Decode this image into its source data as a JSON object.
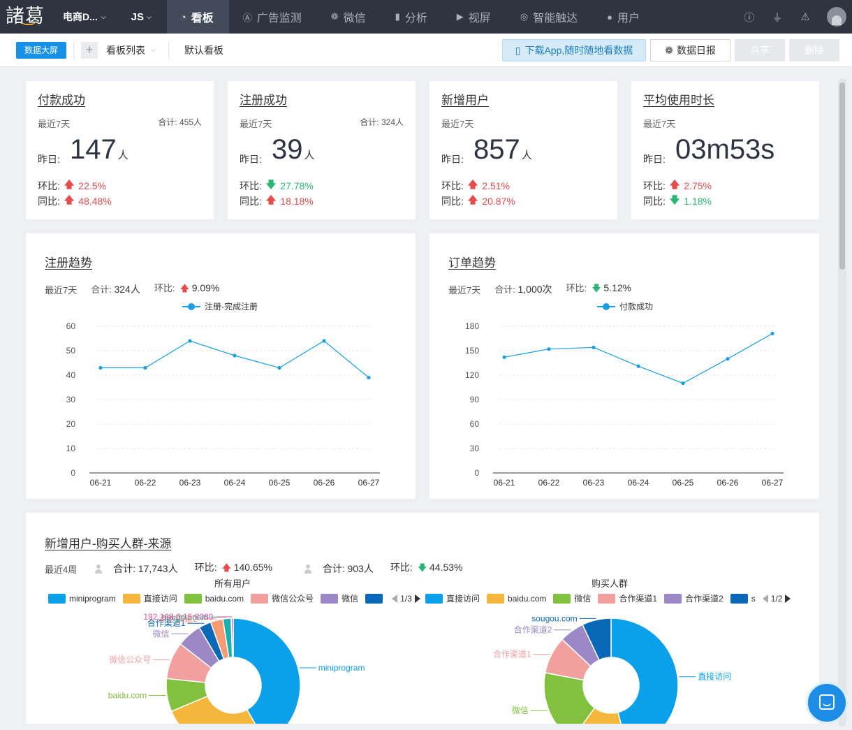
{
  "nav": {
    "logo": "諸葛",
    "project": "电商D...",
    "sdk": "JS",
    "items": [
      {
        "label": "看板",
        "icon": "chart-icon",
        "active": true
      },
      {
        "label": "广告监测",
        "icon": "ad-icon",
        "active": false
      },
      {
        "label": "微信",
        "icon": "wechat-icon",
        "active": false
      },
      {
        "label": "分析",
        "icon": "bar-chart-icon",
        "active": false
      },
      {
        "label": "视屏",
        "icon": "video-icon",
        "active": false
      },
      {
        "label": "智能触达",
        "icon": "target-icon",
        "active": false
      },
      {
        "label": "用户",
        "icon": "user-icon",
        "active": false
      }
    ]
  },
  "toolbar": {
    "screen_btn": "数据大屏",
    "board_list": "看板列表",
    "default_board": "默认看板",
    "download_app": "下载App,随时随地看数据",
    "daily_report": "数据日报",
    "share": "共享",
    "delete": "删除"
  },
  "kpis": [
    {
      "title": "付款成功",
      "period": "最近7天",
      "total": "合计: 455人",
      "yesterday_label": "昨日:",
      "value": "147",
      "unit": "人",
      "hb_label": "环比:",
      "hb": "22.5%",
      "hb_dir": "up",
      "tb_label": "同比:",
      "tb": "48.48%",
      "tb_dir": "up"
    },
    {
      "title": "注册成功",
      "period": "最近7天",
      "total": "合计: 324人",
      "yesterday_label": "昨日:",
      "value": "39",
      "unit": "人",
      "hb_label": "环比:",
      "hb": "27.78%",
      "hb_dir": "down",
      "tb_label": "同比:",
      "tb": "18.18%",
      "tb_dir": "up"
    },
    {
      "title": "新增用户",
      "period": "最近7天",
      "total": "",
      "yesterday_label": "昨日:",
      "value": "857",
      "unit": "人",
      "hb_label": "环比:",
      "hb": "2.51%",
      "hb_dir": "up",
      "tb_label": "同比:",
      "tb": "20.87%",
      "tb_dir": "up"
    },
    {
      "title": "平均使用时长",
      "period": "最近7天",
      "total": "",
      "yesterday_label": "昨日:",
      "value": "03m53s",
      "unit": "",
      "hb_label": "环比:",
      "hb": "2.75%",
      "hb_dir": "up",
      "tb_label": "同比:",
      "tb": "1.18%",
      "tb_dir": "down"
    }
  ],
  "trend_cards": [
    {
      "title": "注册趋势",
      "period": "最近7天",
      "total_label": "合计:",
      "total": "324人",
      "hb_label": "环比:",
      "hb": "9.09%",
      "hb_dir": "up"
    },
    {
      "title": "订单趋势",
      "period": "最近7天",
      "total_label": "合计:",
      "total": "1,000次",
      "hb_label": "环比:",
      "hb": "5.12%",
      "hb_dir": "down"
    }
  ],
  "pie_card": {
    "title": "新增用户-购买人群-来源",
    "period": "最近4周",
    "left": {
      "total_label": "合计:",
      "total": "17,743人",
      "hb_label": "环比:",
      "hb": "140.65%",
      "hb_dir": "up",
      "pager": "1/3"
    },
    "right": {
      "total_label": "合计:",
      "total": "903人",
      "hb_label": "环比:",
      "hb": "44.53%",
      "hb_dir": "down",
      "pager": "1/2"
    }
  },
  "chart_data": [
    {
      "type": "line",
      "series": [
        {
          "name": "注册-完成注册",
          "values": [
            43,
            43,
            54,
            48,
            43,
            54,
            39
          ]
        }
      ],
      "categories": [
        "06-21",
        "06-22",
        "06-23",
        "06-24",
        "06-25",
        "06-26",
        "06-27"
      ],
      "ylim": [
        0,
        60
      ],
      "yticks": [
        0,
        10,
        20,
        30,
        40,
        50,
        60
      ],
      "grid": true,
      "legend": "top-center",
      "color": "#1a9ee2"
    },
    {
      "type": "line",
      "series": [
        {
          "name": "付款成功",
          "values": [
            142,
            152,
            154,
            131,
            110,
            140,
            171
          ]
        }
      ],
      "categories": [
        "06-21",
        "06-22",
        "06-23",
        "06-24",
        "06-25",
        "06-26",
        "06-27"
      ],
      "ylim": [
        0,
        180
      ],
      "yticks": [
        0,
        30,
        60,
        90,
        120,
        150,
        180
      ],
      "grid": true,
      "legend": "top-center",
      "color": "#1a9ee2"
    },
    {
      "type": "pie",
      "title": "所有用户",
      "legend": "top",
      "legend_items": [
        {
          "label": "miniprogram",
          "color": "#0ba0ea"
        },
        {
          "label": "直接访问",
          "color": "#f4b63b"
        },
        {
          "label": "baidu.com",
          "color": "#82c03f"
        },
        {
          "label": "微信公众号",
          "color": "#f29f9f"
        },
        {
          "label": "微信",
          "color": "#9b88c4"
        },
        {
          "label": "",
          "color": "#0b68b8"
        }
      ],
      "slices": [
        {
          "label": "miniprogram",
          "value": 42,
          "color": "#0ba0ea"
        },
        {
          "label": "直接访问",
          "value": 27,
          "color": "#f4b63b"
        },
        {
          "label": "baidu.com",
          "value": 8,
          "color": "#82c03f"
        },
        {
          "label": "微信公众号",
          "value": 9,
          "color": "#f29f9f"
        },
        {
          "label": "微信",
          "value": 6,
          "color": "#9b88c4"
        },
        {
          "label": "合作渠道1",
          "value": 3,
          "color": "#0b68b8"
        },
        {
          "label": "合作渠道2",
          "value": 3,
          "color": "#f59a72"
        },
        {
          "label": "sougou.com",
          "value": 2,
          "color": "#1bb0b0"
        },
        {
          "label": "192.168.0.15:8080",
          "value": 0.5,
          "color": "#e8559a"
        }
      ]
    },
    {
      "type": "pie",
      "title": "购买人群",
      "legend": "top",
      "legend_items": [
        {
          "label": "直接访问",
          "color": "#0ba0ea"
        },
        {
          "label": "baidu.com",
          "color": "#f4b63b"
        },
        {
          "label": "微信",
          "color": "#82c03f"
        },
        {
          "label": "合作渠道1",
          "color": "#f29f9f"
        },
        {
          "label": "合作渠道2",
          "color": "#9b88c4"
        },
        {
          "label": "s",
          "color": "#0b68b8"
        }
      ],
      "slices": [
        {
          "label": "直接访问",
          "value": 46,
          "color": "#0ba0ea"
        },
        {
          "label": "baidu.com",
          "value": 14,
          "color": "#f4b63b"
        },
        {
          "label": "微信",
          "value": 18,
          "color": "#82c03f"
        },
        {
          "label": "合作渠道1",
          "value": 9,
          "color": "#f29f9f"
        },
        {
          "label": "合作渠道2",
          "value": 6,
          "color": "#9b88c4"
        },
        {
          "label": "sougou.com",
          "value": 7,
          "color": "#0b68b8"
        }
      ]
    }
  ]
}
